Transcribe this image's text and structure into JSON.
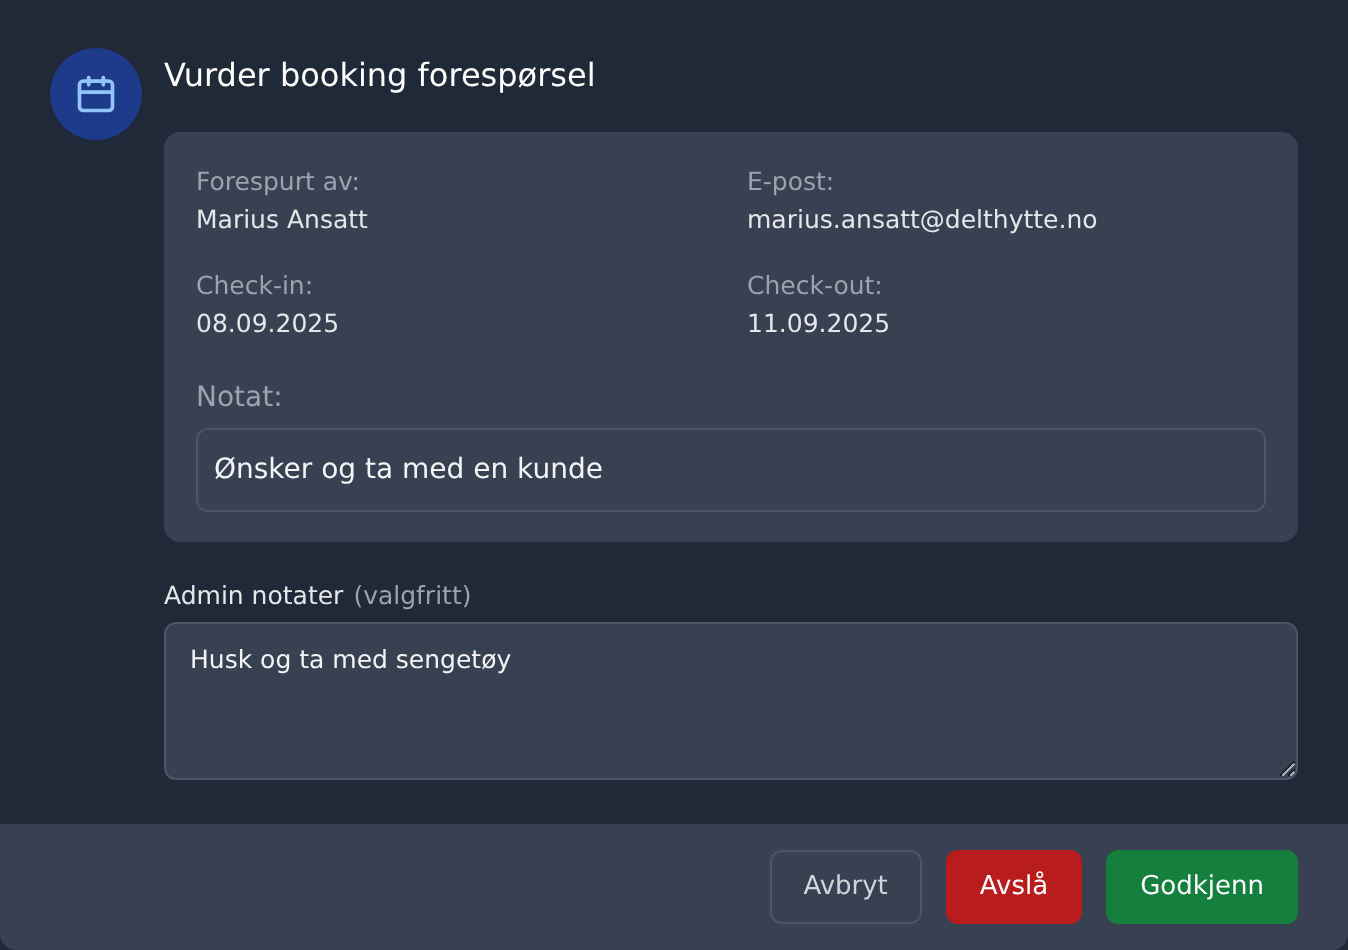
{
  "dialog": {
    "title": "Vurder booking forespørsel",
    "details": [
      {
        "label": "Forespurt av:",
        "value": "Marius Ansatt"
      },
      {
        "label": "E-post:",
        "value": "marius.ansatt@delthytte.no"
      },
      {
        "label": "Check-in:",
        "value": "08.09.2025"
      },
      {
        "label": "Check-out:",
        "value": "11.09.2025"
      }
    ],
    "note": {
      "label": "Notat:",
      "value": "Ønsker og ta med en kunde"
    },
    "admin_notes": {
      "label": "Admin notater",
      "hint": "(valgfritt)",
      "value": "Husk og ta med sengetøy"
    },
    "buttons": [
      {
        "label": "Avbryt",
        "kind": "secondary"
      },
      {
        "label": "Avslå",
        "kind": "danger"
      },
      {
        "label": "Godkjenn",
        "kind": "primary"
      }
    ]
  }
}
